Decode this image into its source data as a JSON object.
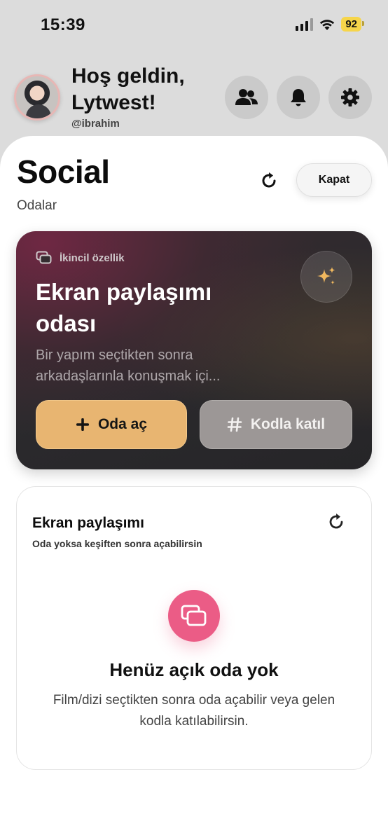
{
  "status_bar": {
    "time": "15:39",
    "battery": "92",
    "icons": [
      "signal-icon",
      "wifi-icon",
      "battery-icon"
    ],
    "battery_color": "#f6d54a"
  },
  "header": {
    "greeting": "Hoş geldin, Lytwest!",
    "username": "@ibrahim",
    "buttons": [
      {
        "icon": "friends-icon"
      },
      {
        "icon": "bell-icon"
      },
      {
        "icon": "gear-icon"
      }
    ]
  },
  "page": {
    "title": "Social",
    "subtitle": "Odalar",
    "close_label": "Kapat",
    "refresh_icon": "refresh-icon"
  },
  "hero": {
    "tag": "İkincil özellik",
    "title": "Ekran paylaşımı odası",
    "description": "Bir yapım seçtikten sonra arkadaşlarınla konuşmak içi...",
    "open_button": "Oda aç",
    "join_button": "Kodla katıl",
    "accent_color": "#e8b571"
  },
  "rooms": {
    "title": "Ekran paylaşımı",
    "subtitle": "Oda yoksa keşiften sonra açabilirsin",
    "empty_title": "Henüz açık oda yok",
    "empty_description": "Film/dizi seçtikten sonra oda açabilir veya gelen kodla katılabilirsin.",
    "empty_icon_color": "#eb5c86"
  }
}
